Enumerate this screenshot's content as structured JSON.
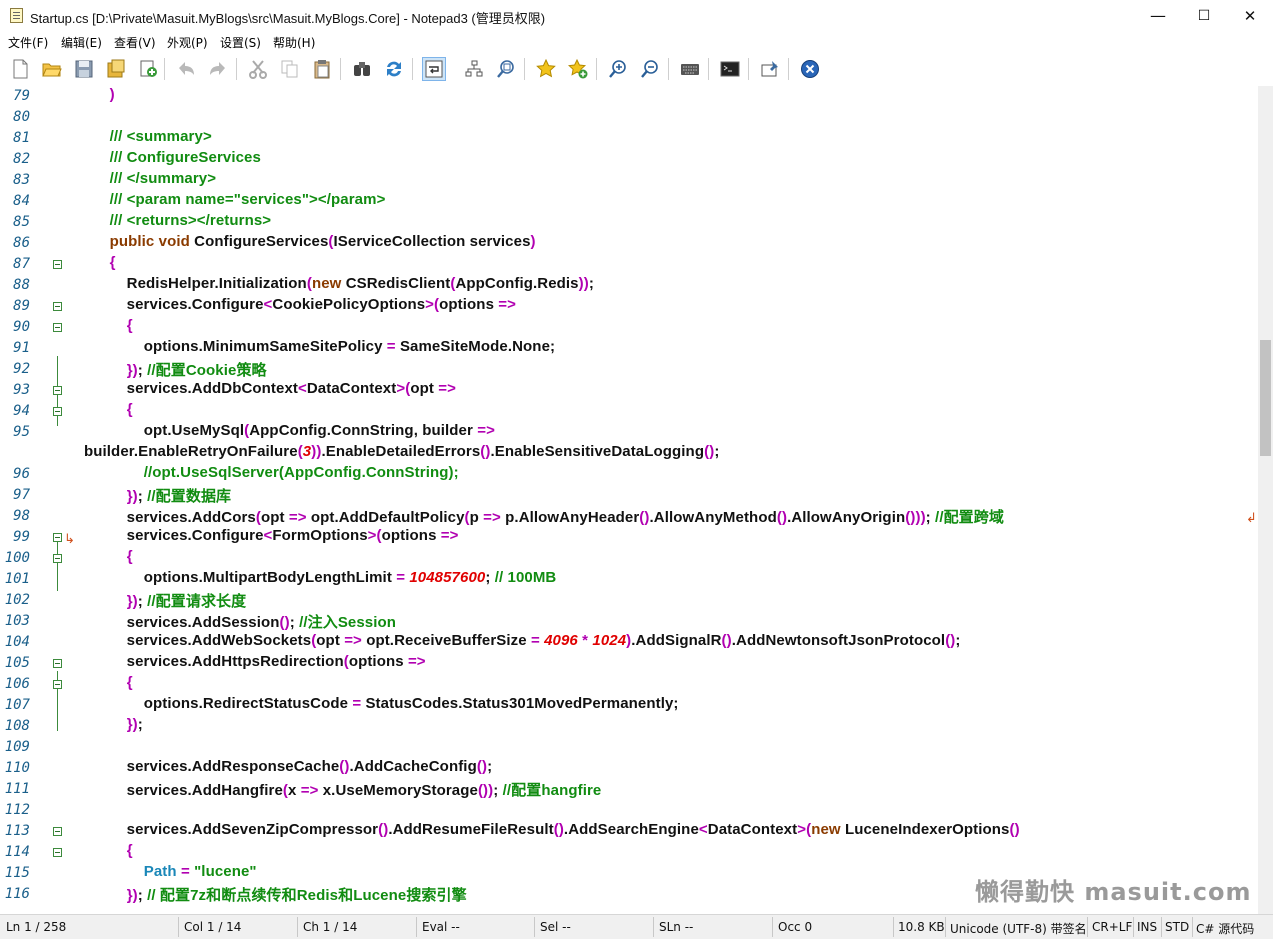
{
  "window": {
    "title": "Startup.cs [D:\\Private\\Masuit.MyBlogs\\src\\Masuit.MyBlogs.Core] - Notepad3  (管理员权限)",
    "minimize": "—",
    "maximize": "☐",
    "close": "✕"
  },
  "menu": [
    "文件(F)",
    "编辑(E)",
    "查看(V)",
    "外观(P)",
    "设置(S)",
    "帮助(H)"
  ],
  "toolbar_icons": [
    "new-icon",
    "open-icon",
    "save-icon",
    "save-as-icon",
    "print-icon",
    "undo-icon",
    "redo-icon",
    "cut-icon",
    "copy-icon",
    "paste-icon",
    "find-icon",
    "replace-icon",
    "word-wrap-icon",
    "tree-icon",
    "zoom-fit-icon",
    "bookmark-icon",
    "add-bookmark-icon",
    "zoom-in-icon",
    "zoom-out-icon",
    "keyboard-icon",
    "console-icon",
    "pin-icon",
    "exit-icon"
  ],
  "lines": [
    {
      "n": "79",
      "t": "      )"
    },
    {
      "n": "80",
      "t": ""
    },
    {
      "n": "81",
      "t": "      /// <summary>"
    },
    {
      "n": "82",
      "t": "      /// ConfigureServices"
    },
    {
      "n": "83",
      "t": "      /// </summary>"
    },
    {
      "n": "84",
      "t": "      /// <param name=\"services\"></param>"
    },
    {
      "n": "85",
      "t": "      /// <returns></returns>"
    },
    {
      "n": "86",
      "t": "      public void ConfigureServices(IServiceCollection services)"
    },
    {
      "n": "87",
      "t": "      {"
    },
    {
      "n": "88",
      "t": "          RedisHelper.Initialization(new CSRedisClient(AppConfig.Redis));"
    },
    {
      "n": "89",
      "t": "          services.Configure<CookiePolicyOptions>(options =>"
    },
    {
      "n": "90",
      "t": "          {"
    },
    {
      "n": "91",
      "t": "              options.MinimumSameSitePolicy = SameSiteMode.None;"
    },
    {
      "n": "92",
      "t": "          }); //配置Cookie策略"
    },
    {
      "n": "93",
      "t": "          services.AddDbContext<DataContext>(opt =>"
    },
    {
      "n": "94",
      "t": "          {"
    },
    {
      "n": "95",
      "t": "              opt.UseMySql(AppConfig.ConnString, builder =>"
    },
    {
      "n": "",
      "t": "builder.EnableRetryOnFailure(3)).EnableDetailedErrors().EnableSensitiveDataLogging();"
    },
    {
      "n": "96",
      "t": "              //opt.UseSqlServer(AppConfig.ConnString);"
    },
    {
      "n": "97",
      "t": "          }); //配置数据库"
    },
    {
      "n": "98",
      "t": "          services.AddCors(opt => opt.AddDefaultPolicy(p => p.AllowAnyHeader().AllowAnyMethod().AllowAnyOrigin())); //配置跨域"
    },
    {
      "n": "99",
      "t": "          services.Configure<FormOptions>(options =>"
    },
    {
      "n": "100",
      "t": "          {"
    },
    {
      "n": "101",
      "t": "              options.MultipartBodyLengthLimit = 104857600; // 100MB"
    },
    {
      "n": "102",
      "t": "          }); //配置请求长度"
    },
    {
      "n": "103",
      "t": "          services.AddSession(); //注入Session"
    },
    {
      "n": "104",
      "t": "          services.AddWebSockets(opt => opt.ReceiveBufferSize = 4096 * 1024).AddSignalR().AddNewtonsoftJsonProtocol();"
    },
    {
      "n": "105",
      "t": "          services.AddHttpsRedirection(options =>"
    },
    {
      "n": "106",
      "t": "          {"
    },
    {
      "n": "107",
      "t": "              options.RedirectStatusCode = StatusCodes.Status301MovedPermanently;"
    },
    {
      "n": "108",
      "t": "          });"
    },
    {
      "n": "109",
      "t": ""
    },
    {
      "n": "110",
      "t": "          services.AddResponseCache().AddCacheConfig();"
    },
    {
      "n": "111",
      "t": "          services.AddHangfire(x => x.UseMemoryStorage()); //配置hangfire"
    },
    {
      "n": "112",
      "t": ""
    },
    {
      "n": "113",
      "t": "          services.AddSevenZipCompressor().AddResumeFileResult().AddSearchEngine<DataContext>(new LuceneIndexerOptions()"
    },
    {
      "n": "114",
      "t": "          {"
    },
    {
      "n": "115",
      "t": "              Path = \"lucene\""
    },
    {
      "n": "116",
      "t": "          }); // 配置7z和断点续传和Redis和Lucene搜索引擎"
    }
  ],
  "status": {
    "ln": "Ln  1 / 258",
    "col": "Col  1 / 14",
    "ch": "Ch  1 / 14",
    "eval": "Eval  --",
    "sel": "Sel  --",
    "sln": "SLn  --",
    "occ": "Occ  0",
    "size": "10.8 KB",
    "encoding": "Unicode (UTF-8) 带签名",
    "eol": "CR+LF",
    "ins": "INS",
    "std": "STD",
    "lang": "C# 源代码"
  },
  "watermark": "懒得勤快  masuit.com"
}
